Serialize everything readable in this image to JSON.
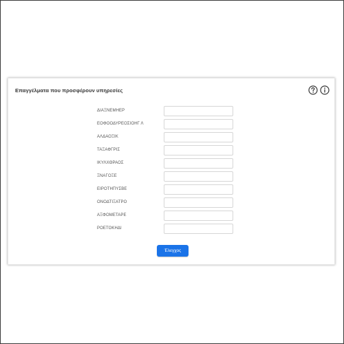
{
  "panel": {
    "title": "Επαγγέλματα που προσφέρουν υπηρεσίες",
    "help_icon": "question-circle-icon",
    "info_icon": "info-circle-icon"
  },
  "form": {
    "rows": [
      {
        "label": "ΔΙΑΞΝΕΜΗΕΡ",
        "value": ""
      },
      {
        "label": "ΕΟΦΟΟΔΥΡΕΟΣΙΟΗΓ Λ",
        "value": ""
      },
      {
        "label": "ΑΛΔΑΟΞΙΚ",
        "value": ""
      },
      {
        "label": "ΤΑΞΑΦΓΡΙΣ",
        "value": ""
      },
      {
        "label": "ΙΚΥΛΧΘΡΑΟΣ",
        "value": ""
      },
      {
        "label": "ΞΝΑΓΟΞΕ",
        "value": ""
      },
      {
        "label": "ΕΙΡΟΤΗΠΥΣΒΕ",
        "value": ""
      },
      {
        "label": "ΟΝΟΔΤΙΞΑΤΡΟ",
        "value": ""
      },
      {
        "label": "ΑΞΦΟΜΕΤΑΡΕ",
        "value": ""
      },
      {
        "label": "ΡΟΕΤΟΚΗΔΙ",
        "value": ""
      }
    ],
    "submit_label": "Έλεγχος"
  },
  "colors": {
    "primary": "#1a73e8",
    "frame_border": "#3a3a3a",
    "input_border": "#d6d6d6",
    "label_text": "#555555"
  }
}
